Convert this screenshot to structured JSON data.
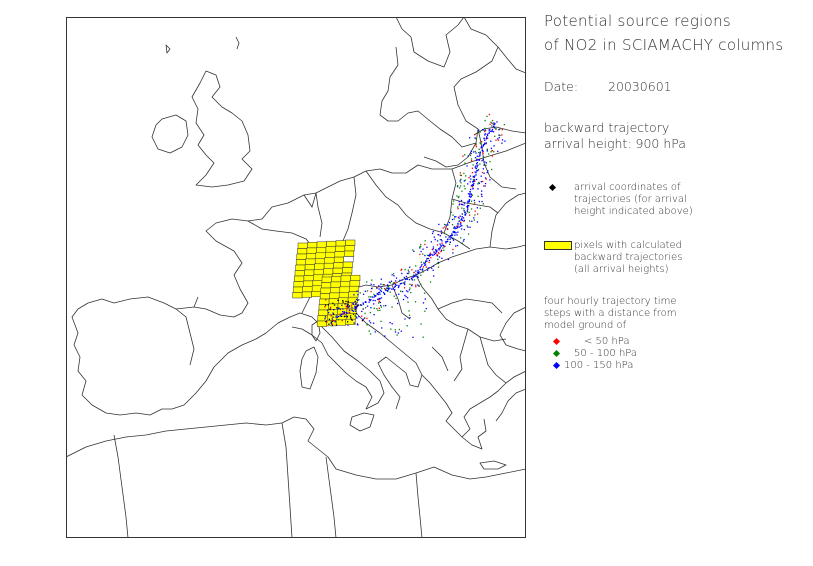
{
  "title_line1": "Potential source regions",
  "title_line2": "of NO2 in SCIAMACHY columns",
  "date_label": "Date:",
  "date_value": "20030601",
  "trajectory_line1": "backward trajectory",
  "trajectory_line2": "arrival height: 900 hPa",
  "legend": {
    "arrival": {
      "lines": [
        "arrival coordinates of",
        "trajectories (for arrival",
        "height indicated above)"
      ],
      "color": "#000000"
    },
    "pixels": {
      "lines": [
        "pixels with calculated",
        "backward trajectories",
        "(all arrival heights)"
      ],
      "color": "#ffff00"
    },
    "steps_intro": [
      "four hourly trajectory time",
      "steps with a distance from",
      "model ground of"
    ],
    "bands": [
      {
        "label": "< 50 hPa",
        "color": "#ff0000"
      },
      {
        "label": "50 - 100 hPa",
        "color": "#008000"
      },
      {
        "label": "100 - 150 hPa",
        "color": "#0000ff"
      }
    ]
  },
  "map": {
    "land_color": "#ffffff",
    "border_color": "#333333"
  }
}
